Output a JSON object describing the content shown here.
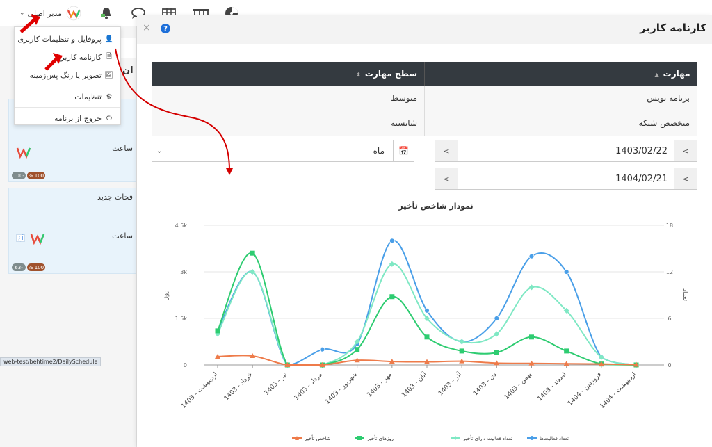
{
  "topbar": {
    "user_label": "مدیر اصلی",
    "icons": [
      "chart-pie-icon",
      "table-columns-icon",
      "calendar-grid-icon",
      "chat-icon",
      "bell-icon"
    ]
  },
  "dropdown": {
    "items": [
      {
        "label": "پروفایل و تنظیمات کاربری",
        "icon": "user-icon"
      },
      {
        "label": "کارنامه کاربر",
        "icon": "document-icon"
      },
      {
        "label": "تصویر یا رنگ پس‌زمینه",
        "icon": "image-icon"
      },
      {
        "label": "تنظیمات",
        "icon": "gear-icon"
      },
      {
        "label": "خروج از برنامه",
        "icon": "power-icon"
      }
    ]
  },
  "left_panel": {
    "heading_fragment": "ان",
    "card1_text": "ساعت",
    "card1_pills": [
      "100 %",
      "-100"
    ],
    "card2_title": "فحات جدید",
    "card2_text": "ساعت",
    "card2_badge": "اَخ",
    "card2_pills": [
      "100 %",
      "-63"
    ]
  },
  "status_url": "web-test/behtime2/DailySchedule",
  "modal": {
    "title": "کارنامه کاربر",
    "close": "×",
    "help": "?"
  },
  "table": {
    "headers": [
      "مهارت",
      "سطح مهارت"
    ],
    "rows": [
      [
        "برنامه نویس",
        "متوسط"
      ],
      [
        "متخصص شبکه",
        "شایسته"
      ]
    ]
  },
  "filters": {
    "period": "ماه",
    "date_from": "1403/02/22",
    "date_to": "1404/02/21"
  },
  "chart_data": {
    "type": "line",
    "title": "نمودار شاخص تأخیر",
    "ylabel_left": "روز",
    "ylabel_right": "تعداد",
    "yticks_left": [
      "0",
      "1.5k",
      "3k",
      "4.5k"
    ],
    "yticks_right": [
      "0",
      "6",
      "12",
      "18"
    ],
    "ylim_left": [
      0,
      4500
    ],
    "ylim_right": [
      0,
      18
    ],
    "categories": [
      "اردیبهشت - 1403",
      "خرداد - 1403",
      "تیر - 1403",
      "مرداد - 1403",
      "شهریور - 1403",
      "مهر - 1403",
      "آبان - 1403",
      "آذر - 1403",
      "دی - 1403",
      "بهمن - 1403",
      "اسفند - 1403",
      "فروردین - 1404",
      "اردیبهشت - 1404"
    ],
    "series": [
      {
        "name": "تعداد فعالیت‌ها",
        "color": "#4a9fe8",
        "marker": "circle",
        "axis": "right",
        "values": [
          4.4,
          12,
          0,
          2,
          2.7,
          16,
          7,
          3,
          6,
          14,
          12,
          1,
          0
        ]
      },
      {
        "name": "تعداد فعالیت دارای تأخیر",
        "color": "#7fe8c4",
        "marker": "diamond",
        "axis": "right",
        "values": [
          4,
          12,
          0,
          0,
          3,
          13,
          6,
          3,
          4,
          10,
          7,
          1,
          0
        ]
      },
      {
        "name": "روزهای تأخیر",
        "color": "#2ecc71",
        "marker": "square",
        "axis": "left",
        "values": [
          1100,
          3600,
          0,
          0,
          500,
          2200,
          900,
          450,
          400,
          900,
          450,
          30,
          0
        ]
      },
      {
        "name": "شاخص تأخیر",
        "color": "#ee7b4a",
        "marker": "triangle",
        "axis": "left",
        "values": [
          270,
          290,
          0,
          0,
          150,
          110,
          100,
          120,
          60,
          50,
          40,
          30,
          10
        ]
      }
    ],
    "legend_position": "bottom",
    "grid": true
  }
}
